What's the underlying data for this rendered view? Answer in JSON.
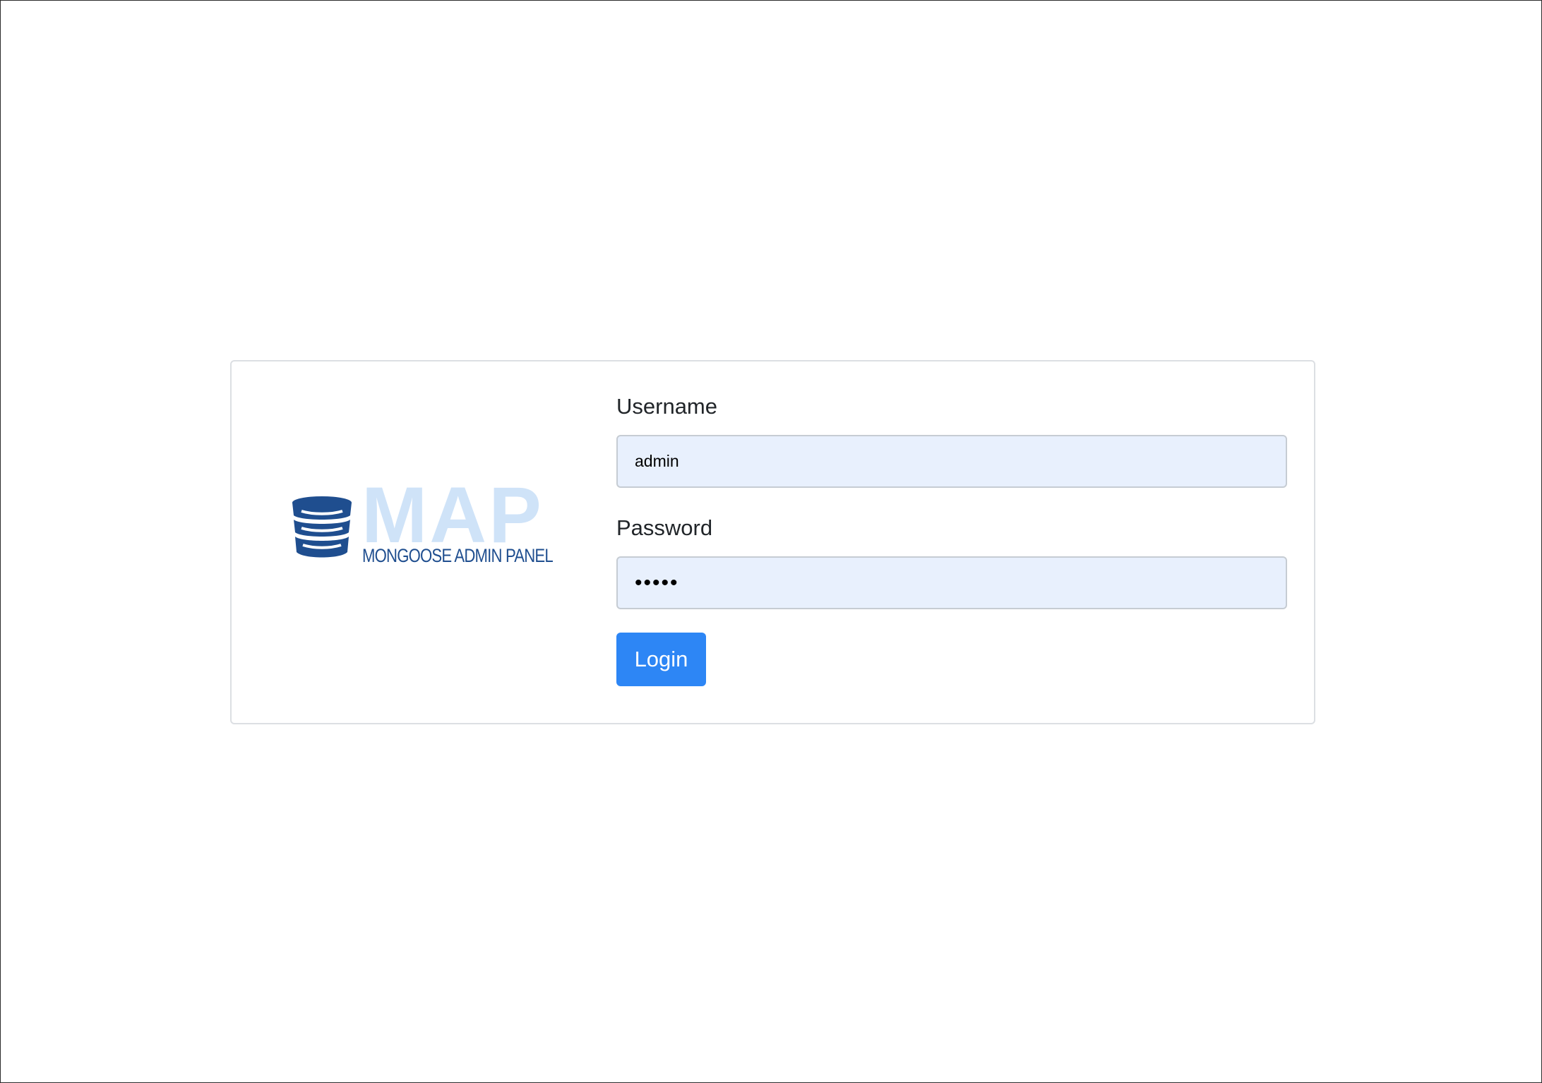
{
  "logo": {
    "icon": "database-stack-icon",
    "wordmark": "MAP",
    "tagline": "MONGOOSE ADMIN PANEL",
    "wordmark_color": "#cfe3f8",
    "accent_color": "#1f4e8f"
  },
  "login_form": {
    "username_label": "Username",
    "username_value": "admin",
    "password_label": "Password",
    "password_value": "admin",
    "login_label": "Login",
    "button_color": "#2d86f5",
    "autofill_background": "#e8f0fd"
  }
}
